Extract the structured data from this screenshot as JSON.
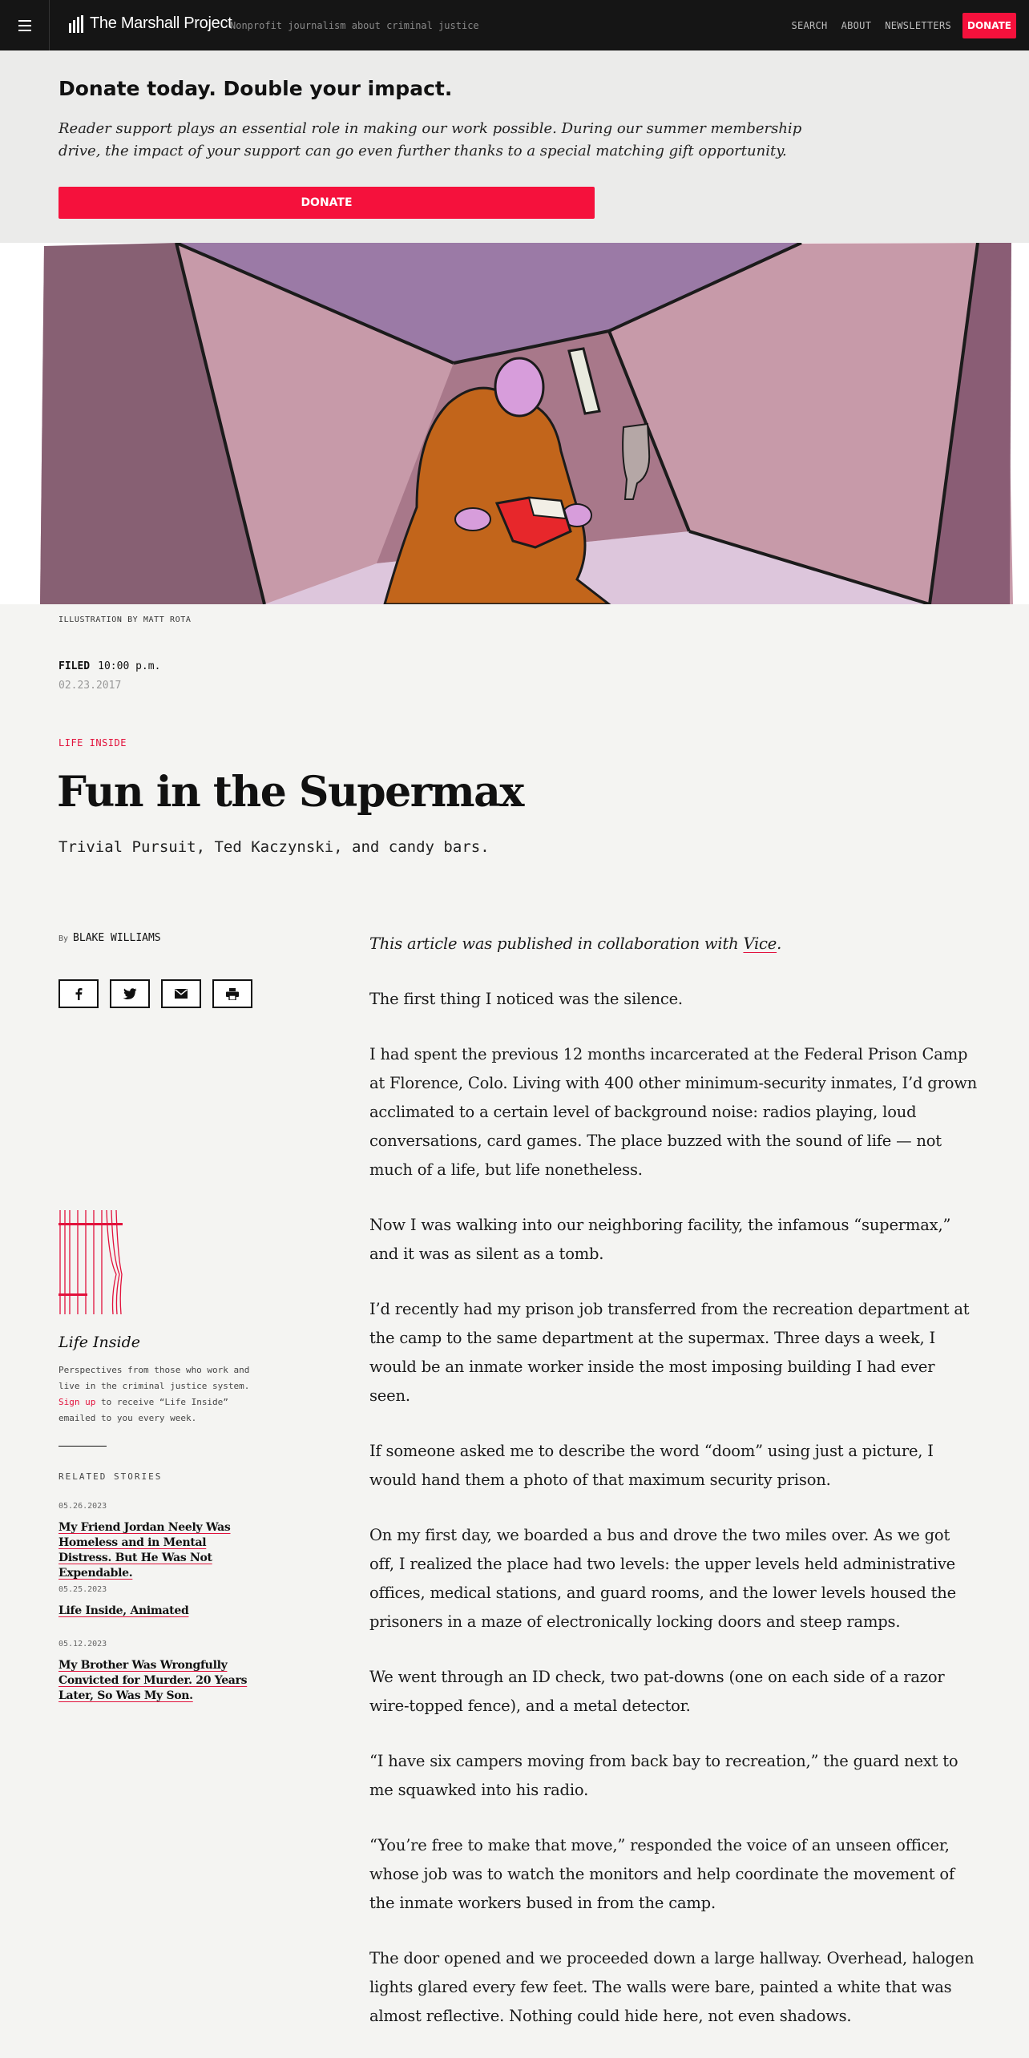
{
  "nav": {
    "logo": "The Marshall Project",
    "tagline": "Nonprofit journalism about criminal justice",
    "links": [
      "SEARCH",
      "ABOUT",
      "NEWSLETTERS"
    ],
    "donate": "DONATE"
  },
  "banner": {
    "heading": "Donate today. Double your impact.",
    "body": "Reader support plays an essential role in making our work possible. During our summer membership drive, the impact of your support can go even further thanks to a special matching gift opportunity.",
    "button": "DONATE"
  },
  "hero": {
    "credit": "ILLUSTRATION BY MATT ROTA"
  },
  "meta": {
    "filed_label": "FILED",
    "filed_time": "10:00 p.m.",
    "filed_date": "02.23.2017",
    "kicker": "LIFE INSIDE",
    "headline": "Fun in the Supermax",
    "dek": "Trivial Pursuit, Ted Kaczynski, and candy bars.",
    "by": "By",
    "author": "BLAKE WILLIAMS"
  },
  "share": [
    "facebook-icon",
    "twitter-icon",
    "email-icon",
    "print-icon"
  ],
  "sidebar": {
    "series_title": "Life Inside",
    "desc_before": "Perspectives from those who work and live in the criminal justice system.",
    "desc_link": "Sign up",
    "desc_after": "to receive “Life Inside” emailed to you every week.",
    "related_label": "RELATED STORIES",
    "related": [
      {
        "date": "05.26.2023",
        "title": "My Friend Jordan Neely Was Homeless and in Mental Distress. But He Was Not Expendable."
      },
      {
        "date": "05.25.2023",
        "title": "Life Inside, Animated"
      },
      {
        "date": "05.12.2023",
        "title": "My Brother Was Wrongfully Convicted for Murder. 20 Years Later, So Was My Son."
      }
    ]
  },
  "article": {
    "intro_before": "This article was published in collaboration with ",
    "intro_link": "Vice",
    "intro_after": ".",
    "paragraphs": [
      "The first thing I noticed was the silence.",
      "I had spent the previous 12 months incarcerated at the Federal Prison Camp at Florence, Colo. Living with 400 other minimum-security inmates, I’d grown acclimated to a certain level of background noise: radios playing, loud conversations, card games. The place buzzed with the sound of life — not much of a life, but life nonetheless.",
      "Now I was walking into our neighboring facility, the infamous “supermax,” and it was as silent as a tomb.",
      "I’d recently had my prison job transferred from the recreation department at the camp to the same department at the supermax. Three days a week, I would be an inmate worker inside the most imposing building I had ever seen.",
      "If someone asked me to describe the word “doom” using just a picture, I would hand them a photo of that maximum security prison.",
      "On my first day, we boarded a bus and drove the two miles over. As we got off, I realized the place had two levels: the upper levels held administrative offices, medical stations, and guard rooms, and the lower levels housed the prisoners in a maze of electronically locking doors and steep ramps.",
      "We went through an ID check, two pat-downs (one on each side of a razor wire-topped fence), and a metal detector.",
      "“I have six campers moving from back bay to recreation,” the guard next to me squawked into his radio.",
      "“You’re free to make that move,” responded the voice of an unseen officer, whose job was to watch the monitors and help coordinate the movement of the inmate workers bused in from the camp.",
      "The door opened and we proceeded down a large hallway. Overhead, halogen lights glared every few feet. The walls were bare, painted a white that was almost reflective. Nothing could hide here, not even shadows."
    ]
  },
  "colors": {
    "accent": "#f5113c",
    "nav_bg": "#151515",
    "banner_bg": "#ebebea",
    "page_bg": "#f4f4f2"
  }
}
